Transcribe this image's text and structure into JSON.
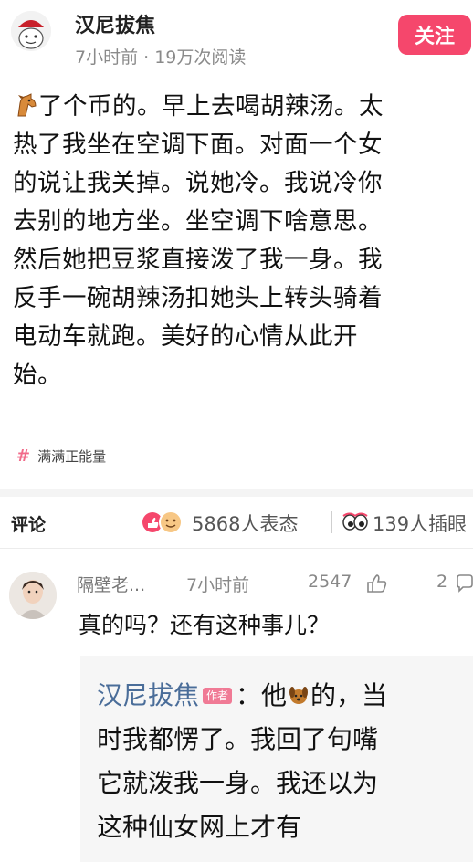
{
  "author": {
    "name": "汉尼拔焦",
    "meta": "7小时前 · 19万次阅读",
    "follow_label": "关注"
  },
  "post": {
    "lines": [
      "了个币的。早上去喝胡辣汤。太",
      "热了我坐在空调下面。对面一个女",
      "的说让我关掉。说她冷。我说冷你",
      "去别的地方坐。坐空调下啥意思。",
      "然后她把豆浆直接泼了我一身。我",
      "反手一碗胡辣汤扣她头上转头骑着",
      "电动车就跑。美好的心情从此开",
      "始。"
    ],
    "topic": "满满正能量"
  },
  "stats": {
    "comment_label": "评论",
    "reactions": "5868人表态",
    "illustrations": "139人插眼"
  },
  "comment": {
    "user": "隔壁老...",
    "time": "7小时前",
    "likes": "2547",
    "replies": "2",
    "text": "真的吗？还有这种事儿？"
  },
  "reply": {
    "author": "汉尼拔焦",
    "badge": "作者",
    "line1_prefix": "：他",
    "line1_suffix": "的，当",
    "line2": "时我都愣了。我回了句嘴",
    "line3": "它就泼我一身。我还以为",
    "line4": "这种仙女网上才有"
  },
  "colors": {
    "accent": "#f5476c",
    "reply_author": "#4a6d99",
    "badge": "#f07a95"
  },
  "icons": [
    "horse-emoji",
    "dog-emoji",
    "like-icon",
    "reaction-icons",
    "eyes-icon",
    "hash-icon"
  ]
}
